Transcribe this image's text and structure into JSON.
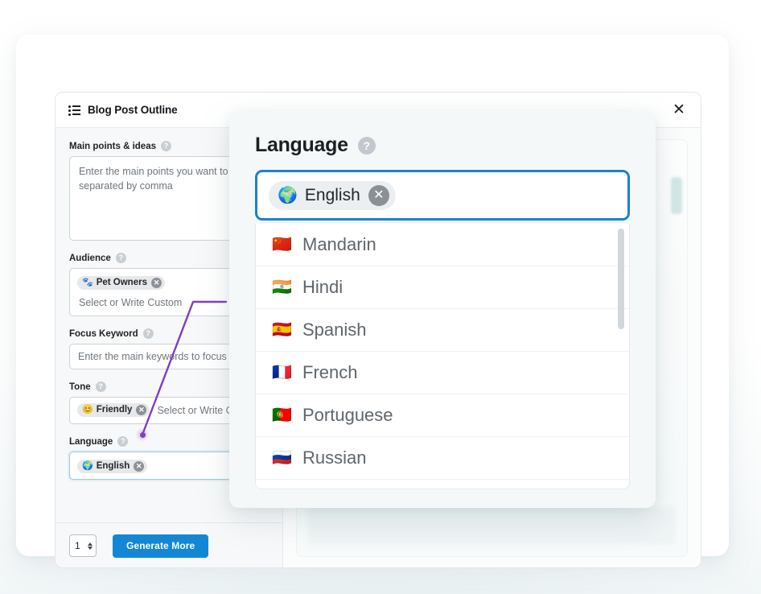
{
  "modal": {
    "title": "Blog Post Outline",
    "title_icon": "outline-list-icon",
    "close_label": "✕"
  },
  "help_glyph": "?",
  "form": {
    "main_points": {
      "label": "Main points & ideas",
      "placeholder": "Enter the main points you want to cover, separated by comma",
      "value": ""
    },
    "audience": {
      "label": "Audience",
      "chip": {
        "emoji": "🐾",
        "label": "Pet Owners",
        "remove": "✕"
      },
      "placeholder": "Select or Write Custom"
    },
    "focus_keyword": {
      "label": "Focus Keyword",
      "placeholder": "Enter the main keywords to focus on",
      "value": ""
    },
    "tone": {
      "label": "Tone",
      "chip": {
        "emoji": "😊",
        "label": "Friendly",
        "remove": "✕"
      },
      "placeholder": "Select or Write Custom"
    },
    "language": {
      "label": "Language",
      "chip": {
        "emoji": "🌍",
        "label": "English",
        "remove": "✕"
      }
    }
  },
  "footer": {
    "count_value": "1",
    "generate_label": "Generate More"
  },
  "language_popup": {
    "heading": "Language",
    "selected": {
      "emoji": "🌍",
      "label": "English",
      "remove": "✕"
    },
    "options": [
      {
        "emoji": "🇨🇳",
        "label": "Mandarin"
      },
      {
        "emoji": "🇮🇳",
        "label": "Hindi"
      },
      {
        "emoji": "🇪🇸",
        "label": "Spanish"
      },
      {
        "emoji": "🇫🇷",
        "label": "French"
      },
      {
        "emoji": "🇵🇹",
        "label": "Portuguese"
      },
      {
        "emoji": "🇷🇺",
        "label": "Russian"
      }
    ]
  },
  "colors": {
    "accent_blue": "#1387d6",
    "focus_blue": "#1b82cd",
    "annotation_purple": "#7e3fc4",
    "panel_bg": "#f7f8f9",
    "chip_bg": "#e6e8ea"
  }
}
